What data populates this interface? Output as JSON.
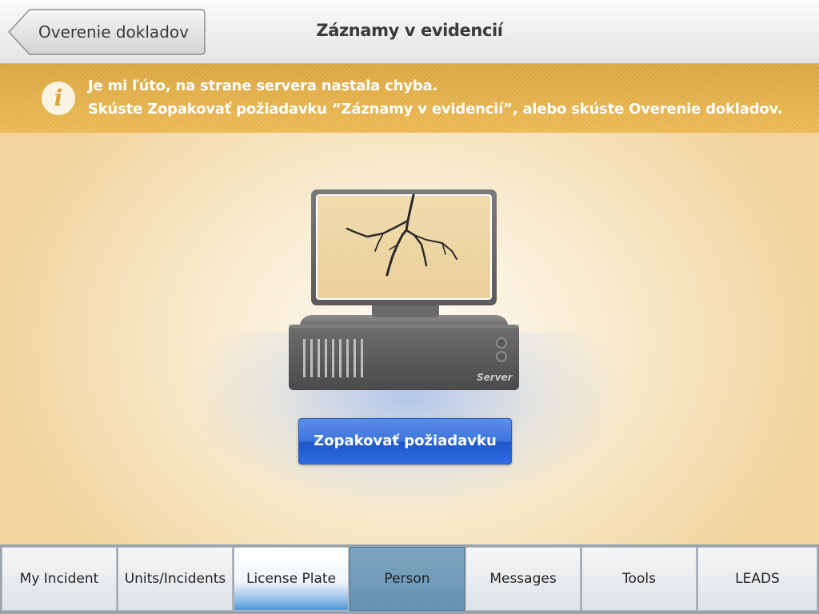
{
  "header": {
    "back_label": "Overenie dokladov",
    "title": "Záznamy v evidencií"
  },
  "banner": {
    "icon": "info-icon",
    "line1": "Je mi ľúto, na strane servera nastala chyba.",
    "line2": "Skúste Zopakovať požiadavku “Záznamy v evidencií”, alebo skúste Overenie dokladov."
  },
  "illustration": {
    "icon": "broken-server-icon",
    "label": "Server"
  },
  "retry_button": {
    "label": "Zopakovať požiadavku"
  },
  "tabs": [
    {
      "label": "My Incident",
      "state": "normal"
    },
    {
      "label": "Units/Incidents",
      "state": "normal"
    },
    {
      "label": "License Plate",
      "state": "selected"
    },
    {
      "label": "Person",
      "state": "pressed"
    },
    {
      "label": "Messages",
      "state": "normal"
    },
    {
      "label": "Tools",
      "state": "normal"
    },
    {
      "label": "LEADS",
      "state": "normal"
    }
  ],
  "colors": {
    "banner": "#e6b04a",
    "accent_blue": "#2e6de0"
  }
}
